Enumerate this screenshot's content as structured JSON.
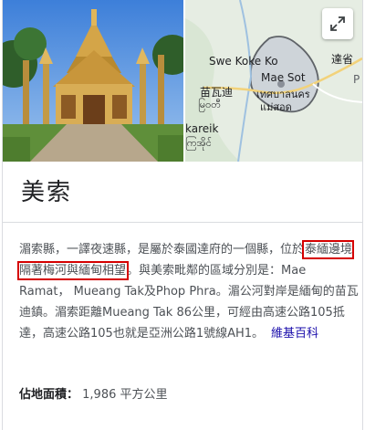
{
  "title": "美索",
  "description": {
    "pre": "湄索縣，一譯夜速縣，是屬於泰國達府的一個縣，位於",
    "highlight": "泰緬邊境隔著梅河與緬甸相望",
    "post": "。與美索毗鄰的區域分別是：Mae Ramat， Mueang Tak及Phop Phra。湄公河對岸是緬甸的苗瓦迪鎮。湄索距離Mueang Tak 86公里，可經由高速公路105抵達，高速公路105也就是亞洲公路1號線AH1。",
    "source_link": "維基百科"
  },
  "facts": [
    {
      "label": "佔地面積：",
      "value": "1,986 平方公里"
    }
  ],
  "map": {
    "labels": {
      "swe_koke_ko": "Swe Koke Ko",
      "mae_sot": "Mae Sot",
      "mae_sot_thai_1": "เทศบาลนคร",
      "mae_sot_thai_2": "แม่สอด",
      "myawaddy_cn": "苗瓦迪",
      "myawaddy_my": "မြဝတီ",
      "kareik": "kareik",
      "kareik_my": "ကြအိုင်",
      "tak_cn": "達省",
      "right_edge": "P"
    },
    "expand_icon": "expand-icon"
  },
  "colors": {
    "highlight_border": "#d50000",
    "link": "#1a0dab",
    "map_land": "#e8efe6",
    "map_region": "#c5cbd6",
    "map_border": "#5f6368"
  }
}
